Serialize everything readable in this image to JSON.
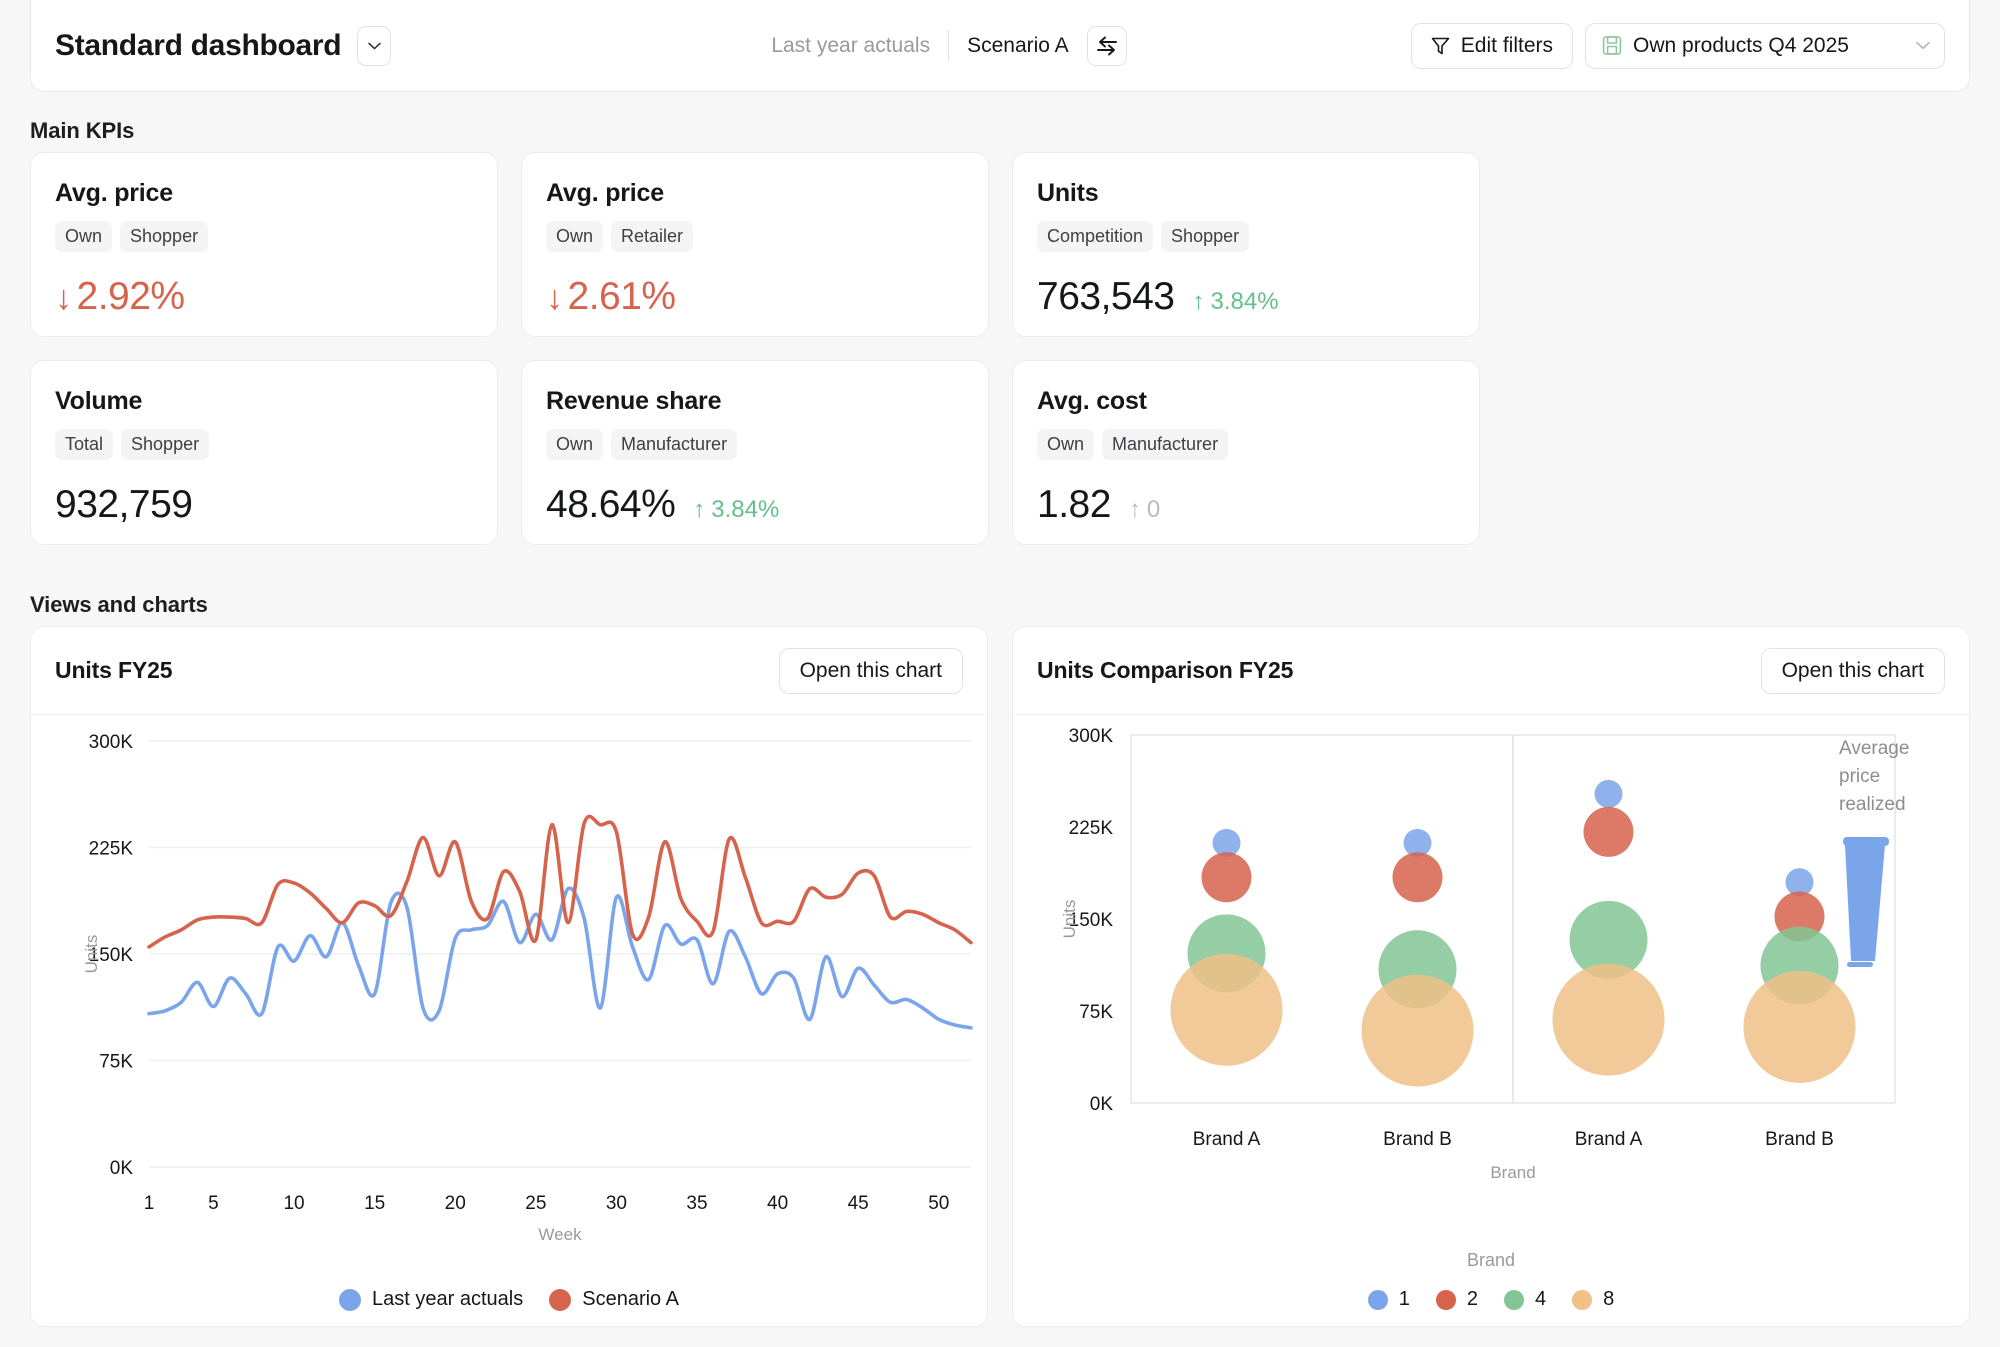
{
  "header": {
    "title": "Standard dashboard",
    "dropdown_icon": "chevron-down-icon",
    "scenario_baseline": "Last year actuals",
    "scenario_active": "Scenario A",
    "swap_icon": "swap-arrows-icon",
    "edit_filters_label": "Edit filters",
    "filter_icon": "funnel-icon",
    "product_selection": "Own products Q4 2025",
    "product_icon": "save-disk-icon",
    "product_chevron_icon": "chevron-down-icon"
  },
  "sections": {
    "main_kpis": "Main KPIs",
    "views_and_charts": "Views and charts"
  },
  "kpis": [
    {
      "title": "Avg. price",
      "chips": [
        "Own",
        "Shopper"
      ],
      "value": "2.92%",
      "direction": "down",
      "arrow": "↓",
      "delta": "",
      "delta_dir": ""
    },
    {
      "title": "Avg. price",
      "chips": [
        "Own",
        "Retailer"
      ],
      "value": "2.61%",
      "direction": "down",
      "arrow": "↓",
      "delta": "",
      "delta_dir": ""
    },
    {
      "title": "Units",
      "chips": [
        "Competition",
        "Shopper"
      ],
      "value": "763,543",
      "direction": "none",
      "arrow": "",
      "delta": "3.84%",
      "delta_dir": "up",
      "delta_arrow": "↑"
    },
    {
      "title": "Volume",
      "chips": [
        "Total",
        "Shopper"
      ],
      "value": "932,759",
      "direction": "none",
      "arrow": "",
      "delta": "",
      "delta_dir": ""
    },
    {
      "title": "Revenue share",
      "chips": [
        "Own",
        "Manufacturer"
      ],
      "value": "48.64%",
      "direction": "none",
      "arrow": "",
      "delta": "3.84%",
      "delta_dir": "up",
      "delta_arrow": "↑"
    },
    {
      "title": "Avg. cost",
      "chips": [
        "Own",
        "Manufacturer"
      ],
      "value": "1.82",
      "direction": "none",
      "arrow": "",
      "delta": "0",
      "delta_dir": "flat",
      "delta_arrow": "↑"
    }
  ],
  "colors": {
    "blue": "#7ba5ea",
    "red": "#d6634c",
    "green": "#82c495",
    "orange": "#f0c086",
    "up_green": "#63c089",
    "muted": "#9a9a9e"
  },
  "cards": {
    "line_chart": {
      "title": "Units FY25",
      "open_label": "Open this chart"
    },
    "bubble_chart": {
      "title": "Units Comparison FY25",
      "open_label": "Open this chart"
    }
  },
  "chart_data": [
    {
      "id": "units-fy25",
      "type": "line",
      "title": "Units FY25",
      "xlabel": "Week",
      "ylabel": "Units",
      "xticks": [
        1,
        5,
        10,
        15,
        20,
        25,
        30,
        35,
        40,
        45,
        50
      ],
      "yticks": [
        "0K",
        "75K",
        "150K",
        "225K",
        "300K"
      ],
      "ytick_values": [
        0,
        75000,
        150000,
        225000,
        300000
      ],
      "xlim": [
        1,
        52
      ],
      "ylim": [
        0,
        300000
      ],
      "grid": true,
      "legend_position": "bottom",
      "series": [
        {
          "name": "Last year actuals",
          "color": "#7ba5ea",
          "values": [
            108000,
            110000,
            116000,
            130000,
            113000,
            133000,
            122000,
            108000,
            155000,
            145000,
            163000,
            148000,
            172000,
            142000,
            122000,
            186000,
            183000,
            112000,
            110000,
            161000,
            167000,
            170000,
            187000,
            158000,
            178000,
            160000,
            196000,
            175000,
            112000,
            190000,
            155000,
            132000,
            170000,
            157000,
            160000,
            129000,
            166000,
            148000,
            122000,
            136000,
            133000,
            104000,
            148000,
            120000,
            140000,
            128000,
            116000,
            118000,
            112000,
            104000,
            100000,
            98000
          ]
        },
        {
          "name": "Scenario A",
          "color": "#d6634c",
          "values": [
            155000,
            162000,
            167000,
            174000,
            176000,
            176000,
            175000,
            172000,
            199000,
            200000,
            193000,
            182000,
            172000,
            186000,
            184000,
            177000,
            201000,
            232000,
            205000,
            229000,
            187000,
            175000,
            208000,
            194000,
            160000,
            241000,
            172000,
            242000,
            241000,
            236000,
            164000,
            176000,
            229000,
            189000,
            173000,
            166000,
            231000,
            204000,
            172000,
            173000,
            173000,
            196000,
            190000,
            192000,
            207000,
            205000,
            176000,
            180000,
            178000,
            172000,
            167000,
            158000
          ]
        }
      ]
    },
    {
      "id": "units-comparison-fy25",
      "type": "scatter",
      "title": "Units Comparison FY25",
      "xlabel": "Brand",
      "ylabel": "Units",
      "yticks": [
        "0K",
        "75K",
        "150K",
        "225K",
        "300K"
      ],
      "ytick_values": [
        0,
        75000,
        150000,
        225000,
        300000
      ],
      "ylim": [
        0,
        300000
      ],
      "size_legend_title": "Average price realized",
      "size_legend_icon": "tapered-wedge-icon",
      "legend_title": "Brand",
      "legend_position": "bottom",
      "legend": [
        {
          "label": "1",
          "color": "#7ba5ea"
        },
        {
          "label": "2",
          "color": "#d6634c"
        },
        {
          "label": "4",
          "color": "#82c495"
        },
        {
          "label": "8",
          "color": "#f0c086"
        }
      ],
      "panels": [
        {
          "categories": [
            "Brand A",
            "Brand B"
          ],
          "points": [
            {
              "category": "Brand A",
              "units": 212000,
              "size": 1,
              "color": "#7ba5ea"
            },
            {
              "category": "Brand A",
              "units": 184000,
              "size": 2,
              "color": "#d6634c"
            },
            {
              "category": "Brand A",
              "units": 122000,
              "size": 4,
              "color": "#82c495"
            },
            {
              "category": "Brand A",
              "units": 76000,
              "size": 8,
              "color": "#f0c086"
            },
            {
              "category": "Brand B",
              "units": 212000,
              "size": 1,
              "color": "#7ba5ea"
            },
            {
              "category": "Brand B",
              "units": 184000,
              "size": 2,
              "color": "#d6634c"
            },
            {
              "category": "Brand B",
              "units": 109000,
              "size": 4,
              "color": "#82c495"
            },
            {
              "category": "Brand B",
              "units": 59000,
              "size": 8,
              "color": "#f0c086"
            }
          ]
        },
        {
          "categories": [
            "Brand A",
            "Brand B"
          ],
          "points": [
            {
              "category": "Brand A",
              "units": 252000,
              "size": 1,
              "color": "#7ba5ea"
            },
            {
              "category": "Brand A",
              "units": 221000,
              "size": 2,
              "color": "#d6634c"
            },
            {
              "category": "Brand A",
              "units": 133000,
              "size": 4,
              "color": "#82c495"
            },
            {
              "category": "Brand A",
              "units": 68000,
              "size": 8,
              "color": "#f0c086"
            },
            {
              "category": "Brand B",
              "units": 180000,
              "size": 1,
              "color": "#7ba5ea"
            },
            {
              "category": "Brand B",
              "units": 152000,
              "size": 2,
              "color": "#d6634c"
            },
            {
              "category": "Brand B",
              "units": 112000,
              "size": 4,
              "color": "#82c495"
            },
            {
              "category": "Brand B",
              "units": 62000,
              "size": 8,
              "color": "#f0c086"
            }
          ]
        }
      ]
    }
  ]
}
